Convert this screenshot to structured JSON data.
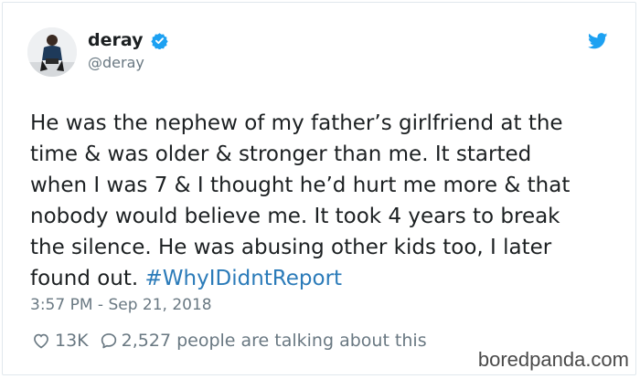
{
  "author": {
    "display_name": "deray",
    "handle": "@deray"
  },
  "icons": {
    "verified": "verified-badge-icon",
    "brand": "twitter-bird-icon",
    "like": "heart-icon",
    "reply": "speech-bubble-icon"
  },
  "tweet": {
    "body": "He was the nephew of my father’s girlfriend at the\ntime & was older & stronger than me. It started\nwhen I was 7 & I thought he’d hurt me more & that\nnobody would believe me. It took 4 years to break\nthe silence. He was abusing other kids too, I later\nfound out. ",
    "hashtag": "#WhyIDidntReport",
    "timestamp": "3:57 PM - Sep 21, 2018"
  },
  "engagement": {
    "likes": "13K",
    "replies_text": "2,527 people are talking about this"
  },
  "watermark": "boredpanda.com",
  "colors": {
    "text": "#1c2022",
    "muted": "#697882",
    "link": "#2b7bb9",
    "twitter_blue": "#1da1f2"
  }
}
